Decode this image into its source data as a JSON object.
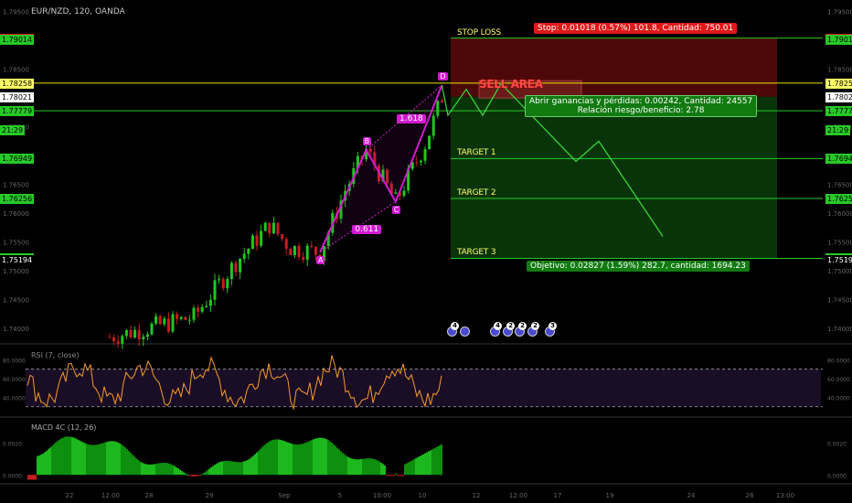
{
  "chart_data": {
    "type": "candlestick",
    "symbol": "EUR/NZD, 120, OANDA",
    "price_axis": {
      "ticks": [
        1.795,
        1.785,
        1.78,
        1.775,
        1.77,
        1.765,
        1.76,
        1.755,
        1.75,
        1.745,
        1.74
      ],
      "tick_labels": [
        "1.79500",
        "1.78500",
        "1.78000",
        "1.77500",
        "1.77000",
        "1.76500",
        "1.76000",
        "1.75500",
        "1.75000",
        "1.74500",
        "1.74000"
      ],
      "range": [
        1.7375,
        1.797
      ]
    },
    "time_axis": {
      "labels": [
        "22",
        "12:00",
        "28",
        "29",
        "Sep",
        "5",
        "10:00",
        "10",
        "12",
        "12:00",
        "17",
        "19",
        "24",
        "26",
        "13:00"
      ],
      "label_x": [
        76,
        121,
        163,
        229,
        311,
        372,
        418,
        462,
        521,
        567,
        610,
        667,
        756,
        820,
        859
      ]
    },
    "price_tags": [
      {
        "value": "1.79039",
        "price": 1.79039,
        "bg": "#e01818",
        "fg": "#ffffff",
        "left": true,
        "right": true
      },
      {
        "value": "1.79014",
        "price": 1.79014,
        "bg": "#27c927",
        "fg": "#000000",
        "left": true,
        "right": true
      },
      {
        "value": "1.78258",
        "price": 1.78258,
        "bg": "#ffff66",
        "fg": "#000000",
        "left": true,
        "right": true
      },
      {
        "value": "1.78021",
        "price": 1.78021,
        "bg": "#ffffff",
        "fg": "#000000",
        "left": true,
        "right": true
      },
      {
        "value": "1.77779",
        "price": 1.77779,
        "bg": "#27c927",
        "fg": "#000000",
        "left": true,
        "right": true
      },
      {
        "value": "21:29",
        "price": 1.7745,
        "bg": "#27c927",
        "fg": "#000000",
        "left": true,
        "right": true
      },
      {
        "value": "1.76949",
        "price": 1.76949,
        "bg": "#27c927",
        "fg": "#000000",
        "left": true,
        "right": true
      },
      {
        "value": "1.76256",
        "price": 1.76256,
        "bg": "#27c927",
        "fg": "#000000",
        "left": true,
        "right": true
      },
      {
        "value": "1.75218",
        "price": 1.75218,
        "bg": "#27c927",
        "fg": "#000000",
        "left": true,
        "right": true
      },
      {
        "value": "1.75194",
        "price": 1.75194,
        "bg": "#000000",
        "fg": "#ffffff",
        "left": true,
        "right": true
      }
    ],
    "trade": {
      "stop_loss_label": "STOP LOSS",
      "stop_price": 1.79039,
      "entry_price": 1.78021,
      "target1_label": "TARGET 1",
      "target1_price": 1.76949,
      "target2_label": "TARGET 2",
      "target2_price": 1.76256,
      "target3_label": "TARGET 3",
      "target3_price": 1.75218,
      "yellow_line_price": 1.78258,
      "green_line_price": 1.77779,
      "stop_box": "Stop: 0.01018 (0.57%) 101.8, Cantidad: 750.01",
      "pnl_line1": "Abrir ganancias y pérdidas: 0.00242, Cantidad: 24557",
      "pnl_line2": "Relación riesgo/beneficio: 2.78",
      "objective_box": "Objetivo: 0.02827 (1.59%) 282.7, cantidad: 1694.23",
      "sell_area": "SELL AREA"
    },
    "pattern": {
      "points": [
        {
          "name": "A",
          "bar": 50,
          "price": 1.7532
        },
        {
          "name": "B",
          "bar": 61,
          "price": 1.771
        },
        {
          "name": "C",
          "bar": 68,
          "price": 1.762
        },
        {
          "name": "D",
          "bar": 79,
          "price": 1.7822
        }
      ],
      "ratios": [
        "0.611",
        "1.618"
      ]
    },
    "projection_prices": [
      1.777,
      1.7815,
      1.777,
      1.7825,
      1.769,
      1.7725,
      1.756
    ],
    "rsi": {
      "label": "RSI (7, close)",
      "ticks": [
        "80.0000",
        "60.0000",
        "40.0000"
      ],
      "upper": 70,
      "lower": 30,
      "range": [
        20,
        95
      ]
    },
    "macd": {
      "label": "MACD 4C (12, 26)",
      "ticks": [
        "0.0020",
        "0.0000"
      ]
    },
    "events": [
      "4",
      "",
      "4",
      "2",
      "2",
      "2",
      "3"
    ]
  }
}
